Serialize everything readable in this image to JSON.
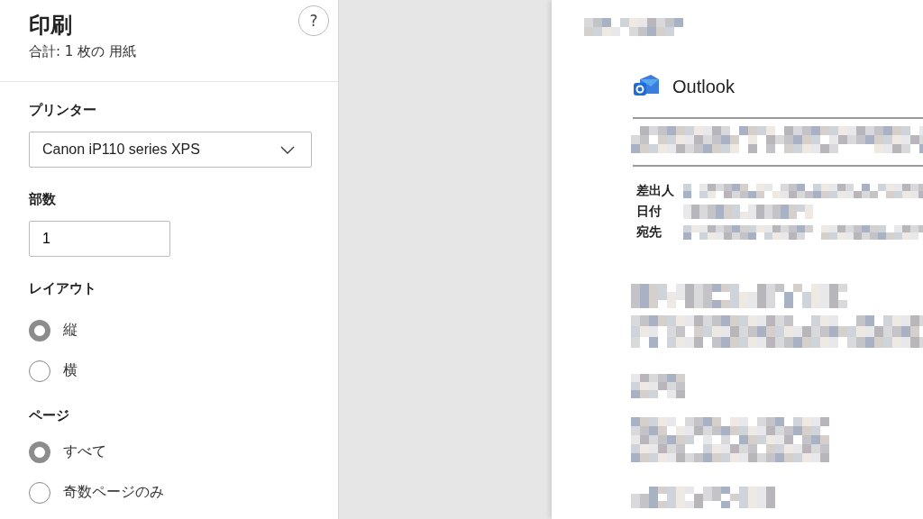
{
  "panel": {
    "title": "印刷",
    "summary": "合計: 1 枚の 用紙",
    "help": "?"
  },
  "printer": {
    "label": "プリンター",
    "value": "Canon iP110 series XPS"
  },
  "copies": {
    "label": "部数",
    "value": "1"
  },
  "layout": {
    "label": "レイアウト",
    "options": [
      {
        "label": "縦",
        "selected": true
      },
      {
        "label": "横",
        "selected": false
      }
    ]
  },
  "pages": {
    "label": "ページ",
    "options": [
      {
        "label": "すべて",
        "selected": true
      },
      {
        "label": "奇数ページのみ",
        "selected": false
      }
    ]
  },
  "preview": {
    "app_name": "Outlook",
    "fields": [
      "差出人",
      "日付",
      "宛先"
    ]
  }
}
